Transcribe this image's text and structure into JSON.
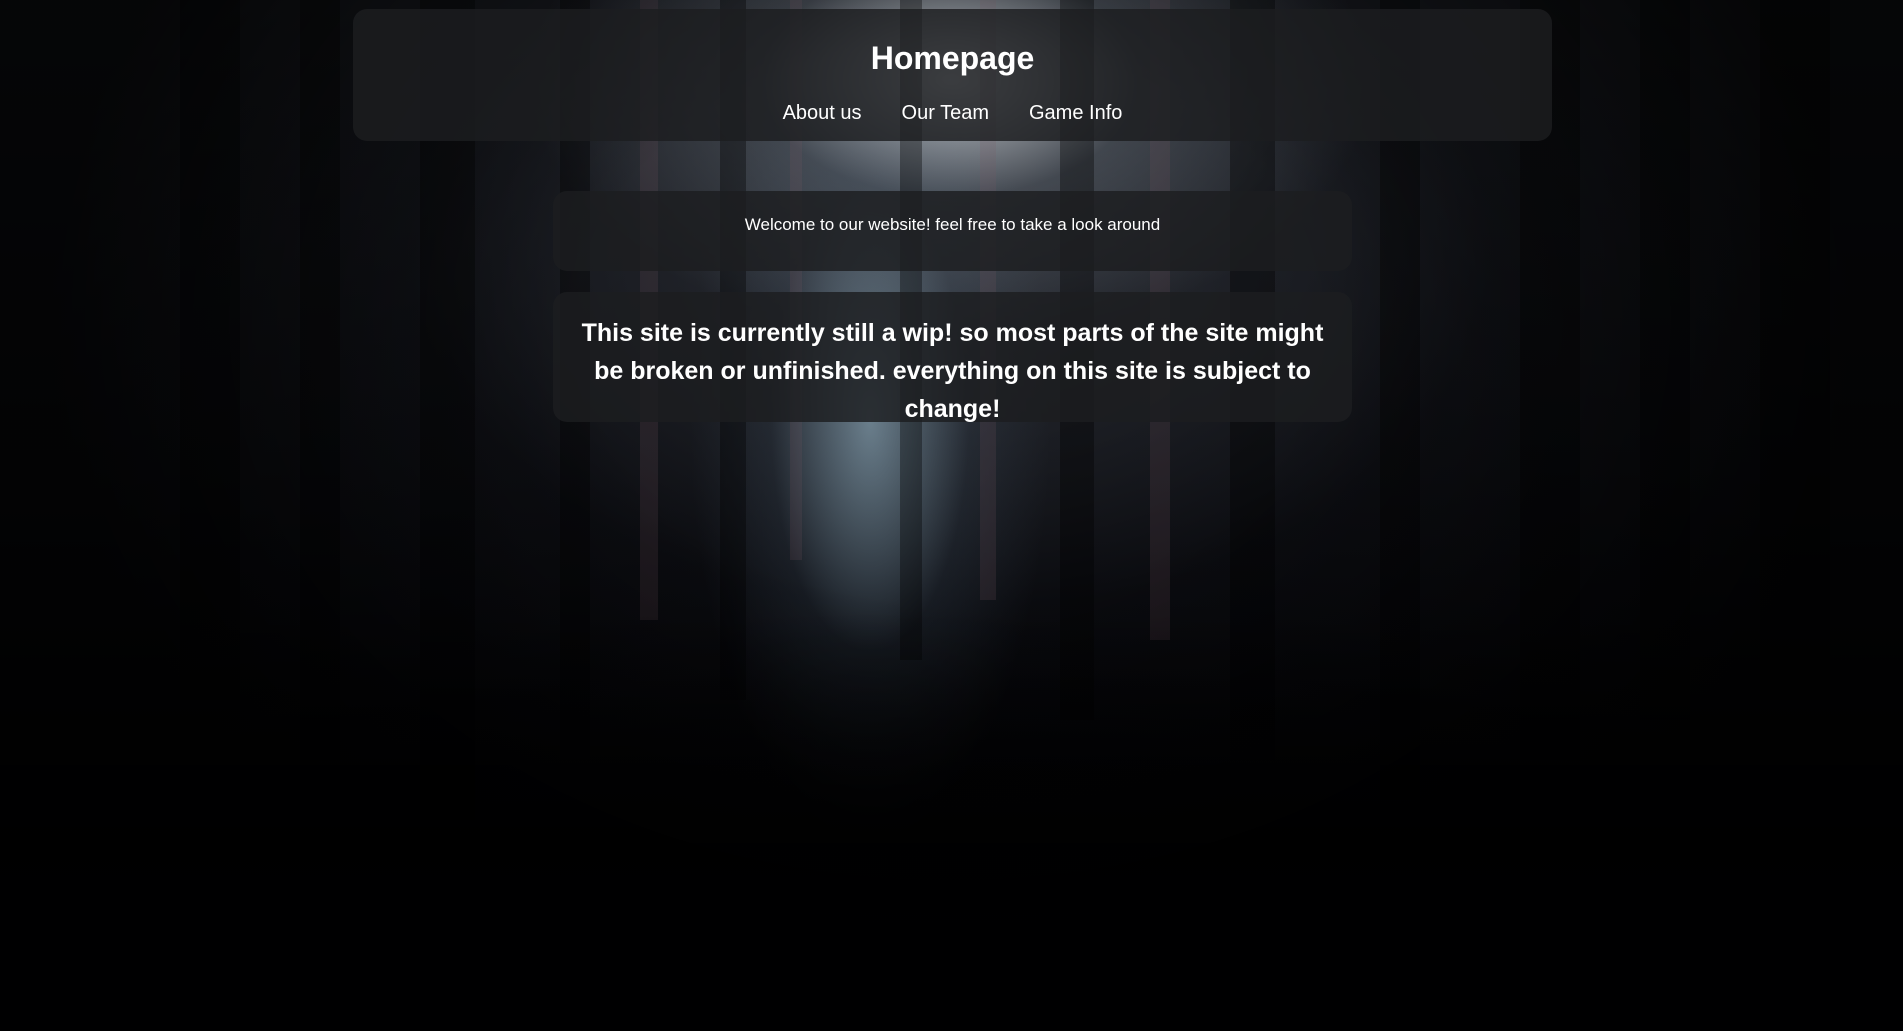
{
  "header": {
    "title": "Homepage",
    "nav": [
      {
        "label": "About us"
      },
      {
        "label": "Our Team"
      },
      {
        "label": "Game Info"
      }
    ]
  },
  "welcome": {
    "text": "Welcome to our website! feel free to take a look around"
  },
  "notice": {
    "text": "This site is currently still a wip! so most parts of the site might be broken or unfinished. everything on this site is subject to change!"
  },
  "colors": {
    "text": "#ffffff",
    "panel": "#1c1d20",
    "background": "#000104"
  }
}
